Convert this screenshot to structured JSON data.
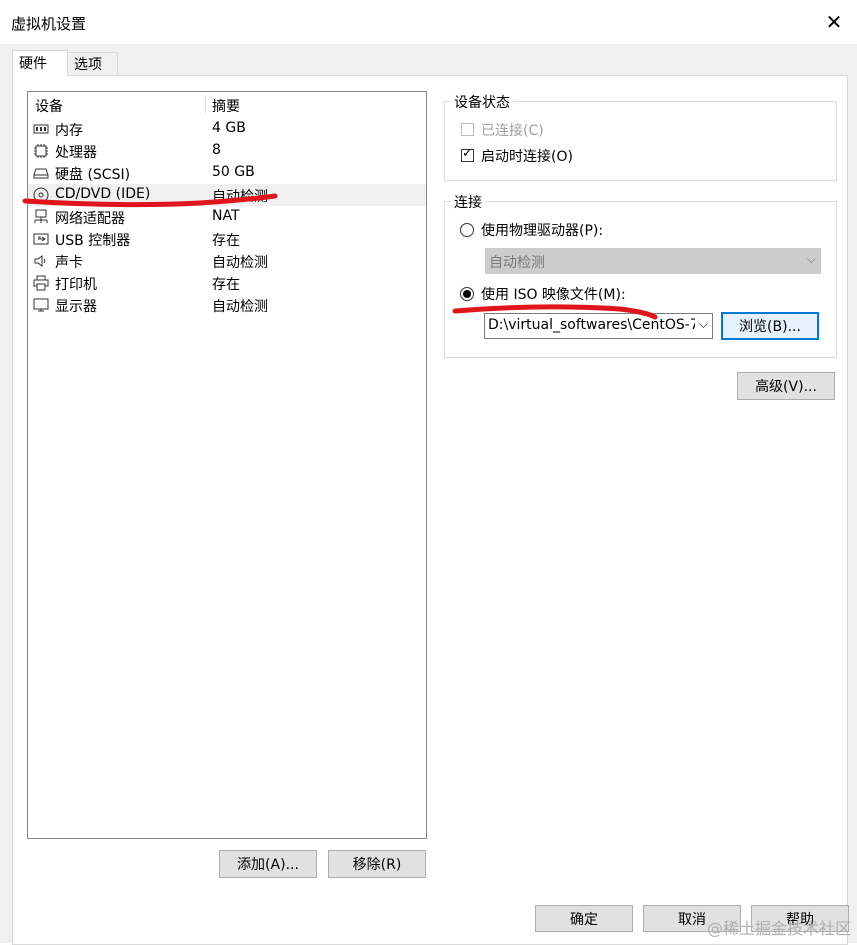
{
  "window": {
    "title": "虚拟机设置",
    "close_glyph": "✕"
  },
  "tabs": [
    {
      "label": "硬件"
    },
    {
      "label": "选项"
    }
  ],
  "device_list": {
    "columns": [
      "设备",
      "摘要"
    ],
    "rows": [
      {
        "name": "内存",
        "summary": "4 GB",
        "icon": "memory-icon"
      },
      {
        "name": "处理器",
        "summary": "8",
        "icon": "processor-icon"
      },
      {
        "name": "硬盘 (SCSI)",
        "summary": "50 GB",
        "icon": "hard-disk-icon"
      },
      {
        "name": "CD/DVD (IDE)",
        "summary": "自动检测",
        "icon": "cd-dvd-icon"
      },
      {
        "name": "网络适配器",
        "summary": "NAT",
        "icon": "network-adapter-icon"
      },
      {
        "name": "USB 控制器",
        "summary": "存在",
        "icon": "usb-icon"
      },
      {
        "name": "声卡",
        "summary": "自动检测",
        "icon": "speaker-icon"
      },
      {
        "name": "打印机",
        "summary": "存在",
        "icon": "printer-icon"
      },
      {
        "name": "显示器",
        "summary": "自动检测",
        "icon": "monitor-icon"
      }
    ],
    "add_button": "添加(A)...",
    "remove_button": "移除(R)"
  },
  "device_status": {
    "title": "设备状态",
    "connected_label": "已连接(C)",
    "connect_on_power_on_label": "启动时连接(O)",
    "connected_checked": false,
    "connect_on_power_on_checked": true
  },
  "connection": {
    "title": "连接",
    "physical_drive_label": "使用物理驱动器(P):",
    "physical_drive_value": "自动检测",
    "iso_label": "使用 ISO 映像文件(M):",
    "iso_path": "D:\\virtual_softwares\\CentOS-7",
    "browse_button": "浏览(B)...",
    "selected": "iso"
  },
  "advanced_button": "高级(V)...",
  "footer": {
    "ok": "确定",
    "cancel": "取消",
    "help": "帮助"
  },
  "watermark": "@稀土掘金技术社区",
  "colors": {
    "annotation_red": "#e0151c",
    "focus_blue": "#0078d7"
  }
}
